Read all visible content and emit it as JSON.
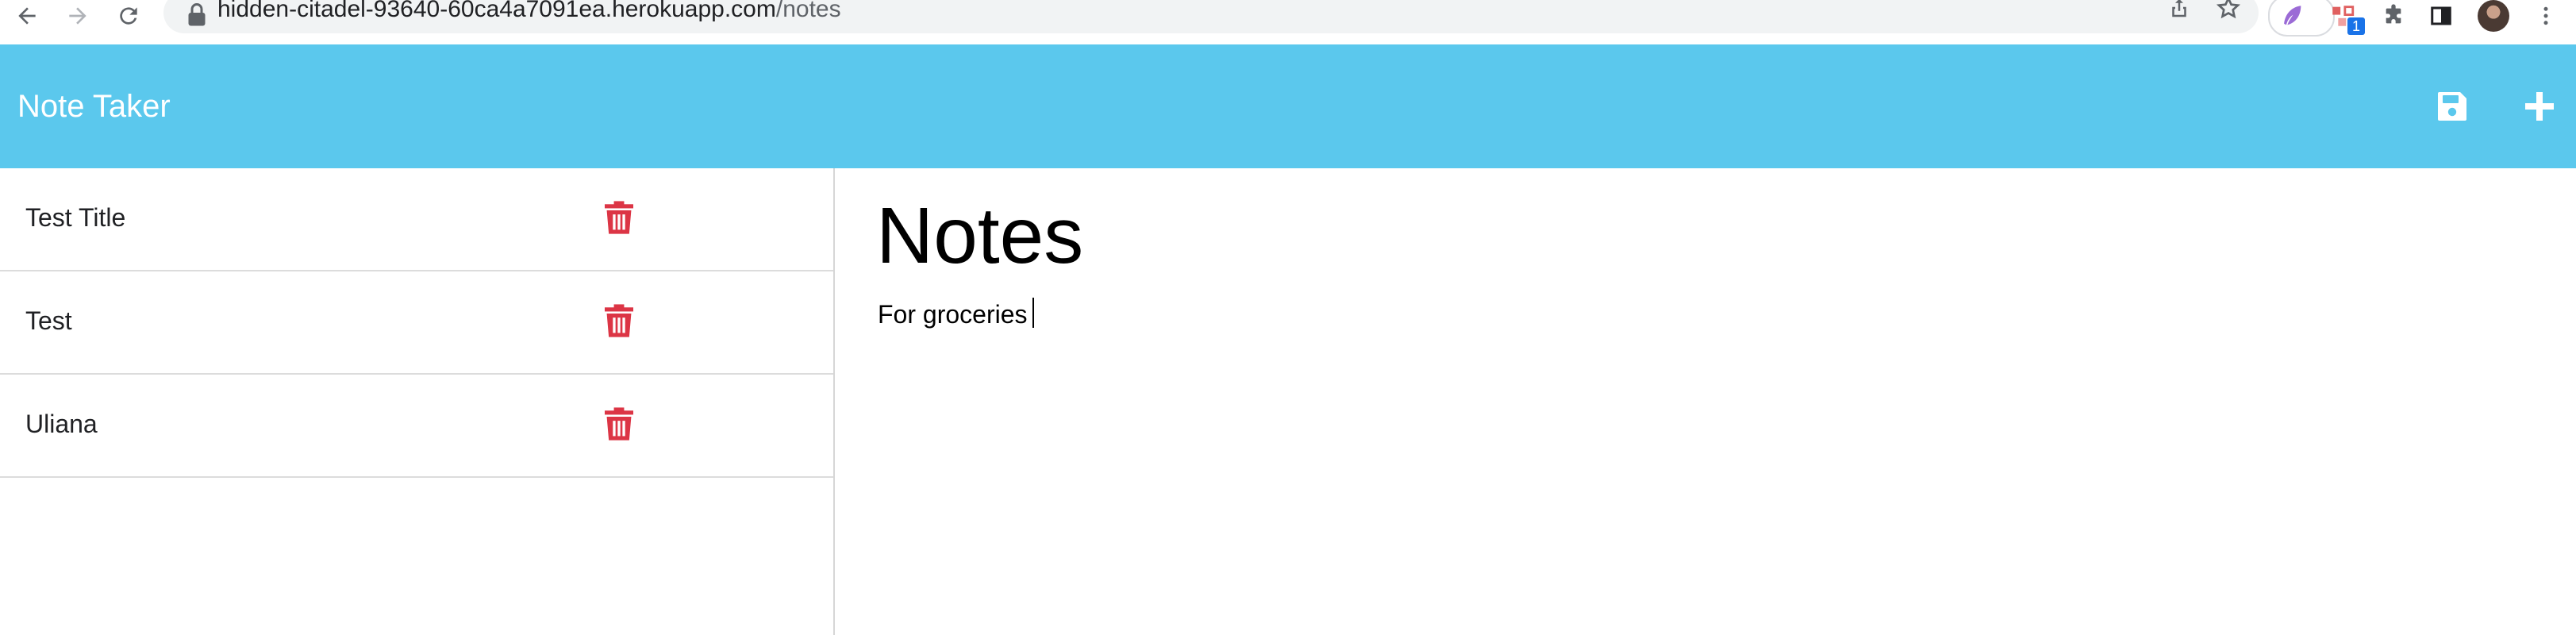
{
  "browser": {
    "url_host": "hidden-citadel-93640-60ca4a7091ea.herokuapp.com",
    "url_path": "/notes",
    "extension_badge": "1"
  },
  "header": {
    "title": "Note Taker"
  },
  "notes": [
    {
      "title": "Test Title"
    },
    {
      "title": "Test"
    },
    {
      "title": "Uliana"
    }
  ],
  "editor": {
    "title": "Notes",
    "body": "For groceries"
  },
  "colors": {
    "header_bg": "#5bc8ed",
    "trash": "#dc3545"
  }
}
